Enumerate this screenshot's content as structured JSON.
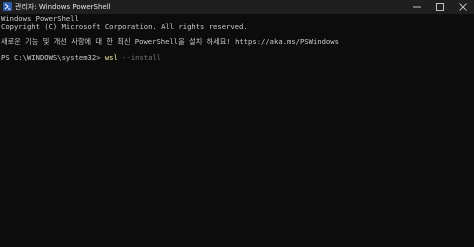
{
  "window": {
    "title": "관리자: Windows PowerShell",
    "icon": "powershell-icon",
    "controls": [
      "minimize-icon",
      "maximize-icon",
      "close-icon"
    ]
  },
  "terminal": {
    "line1": "Windows PowerShell",
    "line2": "Copyright (C) Microsoft Corporation. All rights reserved.",
    "line3": "새로운 기능 및 개선 사항에 대 한 최신 PowerShell을 설치 하세요! https://aka.ms/PSWindows",
    "prompt": "PS C:\\WINDOWS\\system32> ",
    "command": "wsl",
    "argument": " --install"
  },
  "colors": {
    "background": "#0c0c0c",
    "text": "#cccccc",
    "command": "#f9f1a5",
    "argument": "#767676",
    "titlebar": "#1f1f1f"
  }
}
